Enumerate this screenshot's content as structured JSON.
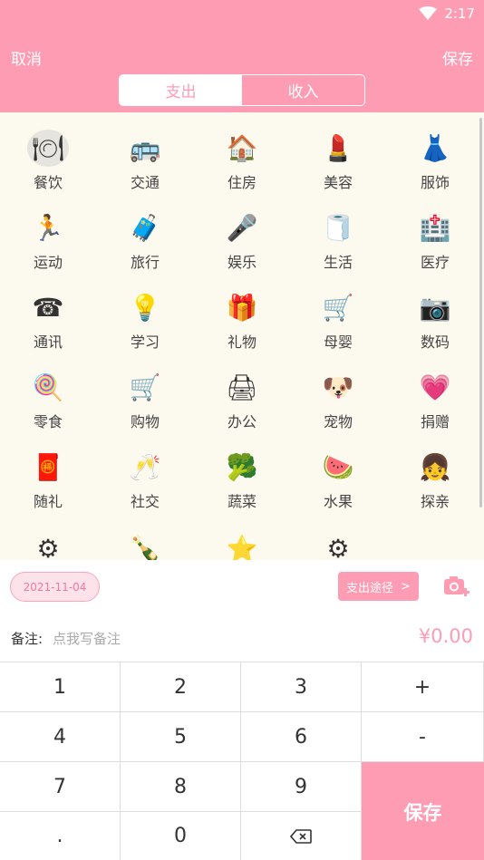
{
  "status": {
    "time": "2:17"
  },
  "header": {
    "cancel_label": "取消",
    "save_label": "保存"
  },
  "tabs": [
    {
      "label": "支出",
      "active": true
    },
    {
      "label": "收入",
      "active": false
    }
  ],
  "categories": [
    {
      "label": "餐饮",
      "icon": "🍽",
      "icon_name": "dining-icon",
      "selected": true
    },
    {
      "label": "交通",
      "icon": "🚌",
      "icon_name": "bus-icon"
    },
    {
      "label": "住房",
      "icon": "🏠",
      "icon_name": "house-icon"
    },
    {
      "label": "美容",
      "icon": "💄",
      "icon_name": "lipstick-icon"
    },
    {
      "label": "服饰",
      "icon": "👗",
      "icon_name": "dress-icon"
    },
    {
      "label": "运动",
      "icon": "🏃",
      "icon_name": "running-icon"
    },
    {
      "label": "旅行",
      "icon": "🧳",
      "icon_name": "suitcase-icon"
    },
    {
      "label": "娱乐",
      "icon": "🎤",
      "icon_name": "microphone-icon"
    },
    {
      "label": "生活",
      "icon": "🧻",
      "icon_name": "tissue-roll-icon"
    },
    {
      "label": "医疗",
      "icon": "🏥",
      "icon_name": "hospital-icon"
    },
    {
      "label": "通讯",
      "icon": "☎",
      "icon_name": "telephone-icon"
    },
    {
      "label": "学习",
      "icon": "💡",
      "icon_name": "lightbulb-icon"
    },
    {
      "label": "礼物",
      "icon": "🎁",
      "icon_name": "gift-icon"
    },
    {
      "label": "母婴",
      "icon": "🛒",
      "icon_name": "baby-stroller-icon"
    },
    {
      "label": "数码",
      "icon": "📷",
      "icon_name": "digital-camera-icon"
    },
    {
      "label": "零食",
      "icon": "🍭",
      "icon_name": "lollipop-icon"
    },
    {
      "label": "购物",
      "icon": "🛒",
      "icon_name": "shopping-cart-icon"
    },
    {
      "label": "办公",
      "icon": "🖨",
      "icon_name": "printer-icon"
    },
    {
      "label": "宠物",
      "icon": "🐶",
      "icon_name": "dog-icon"
    },
    {
      "label": "捐赠",
      "icon": "💗",
      "icon_name": "winged-heart-icon"
    },
    {
      "label": "随礼",
      "icon": "🧧",
      "icon_name": "red-envelope-icon"
    },
    {
      "label": "社交",
      "icon": "🥂",
      "icon_name": "wine-glasses-icon"
    },
    {
      "label": "蔬菜",
      "icon": "🥦",
      "icon_name": "broccoli-icon"
    },
    {
      "label": "水果",
      "icon": "🍉",
      "icon_name": "watermelon-icon"
    },
    {
      "label": "探亲",
      "icon": "👧",
      "icon_name": "girl-face-icon"
    },
    {
      "label": "",
      "icon": "⚙",
      "icon_name": "repair-gear-icon"
    },
    {
      "label": "",
      "icon": "🍾",
      "icon_name": "bottles-icon"
    },
    {
      "label": "",
      "icon": "⭐",
      "icon_name": "star-icon"
    },
    {
      "label": "",
      "icon": "⚙",
      "icon_name": "settings-gear-icon"
    }
  ],
  "info": {
    "date": "2021-11-04",
    "route_label": "支出途径",
    "route_arrow": ">"
  },
  "note": {
    "label": "备注:",
    "placeholder": "点我写备注",
    "amount": "¥0.00"
  },
  "keypad": {
    "keys": [
      "1",
      "2",
      "3",
      "+",
      "4",
      "5",
      "6",
      "-",
      "7",
      "8",
      "9",
      ".",
      "0"
    ],
    "save_label": "保存"
  },
  "colors": {
    "accent": "#fe9cb4",
    "grid_bg": "#fcf9ef"
  }
}
